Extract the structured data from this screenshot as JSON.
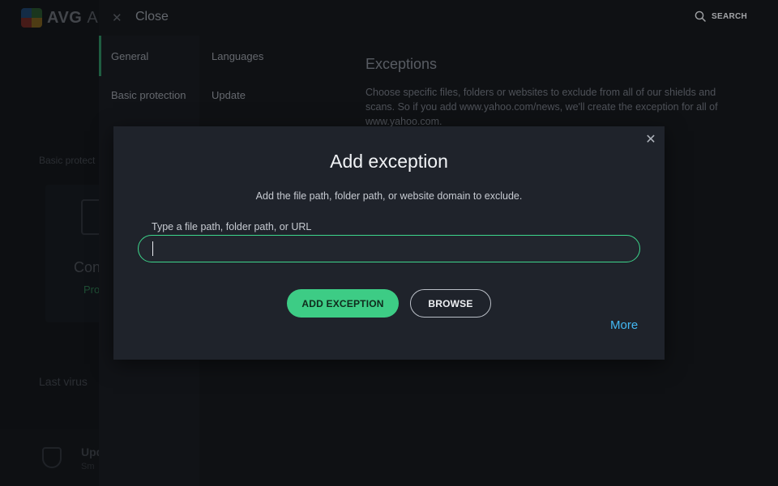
{
  "app": {
    "logo_text": "AVG",
    "title_partial": "An",
    "bg_basic_protection": "Basic protect",
    "bg_card_title": "Con",
    "bg_card_status": "Pro",
    "bg_last_virus": "Last virus",
    "bg_update_title": "Upd",
    "bg_update_sub": "Sm"
  },
  "settings": {
    "close_label": "Close",
    "search_label": "SEARCH",
    "nav_col1": [
      {
        "label": "General"
      },
      {
        "label": "Basic protection"
      }
    ],
    "nav_col2": [
      {
        "label": "Languages"
      },
      {
        "label": "Update"
      }
    ],
    "section_title": "Exceptions",
    "section_desc": "Choose specific files, folders or websites to exclude from all of our shields and scans. So if you add www.yahoo.com/news, we'll create the exception for all of www.yahoo.com."
  },
  "modal": {
    "title": "Add exception",
    "subtitle": "Add the file path, folder path, or website domain to exclude.",
    "field_label": "Type a file path, folder path, or URL",
    "input_value": "",
    "add_button": "ADD EXCEPTION",
    "browse_button": "BROWSE",
    "more_link": "More"
  },
  "colors": {
    "accent_green": "#3dcc85",
    "link_blue": "#43b7f2",
    "modal_bg": "#1f232b"
  },
  "icons": {
    "close": "close-icon",
    "search": "search-icon",
    "modal_close": "close-icon",
    "logo": "avg-logo-icon"
  }
}
